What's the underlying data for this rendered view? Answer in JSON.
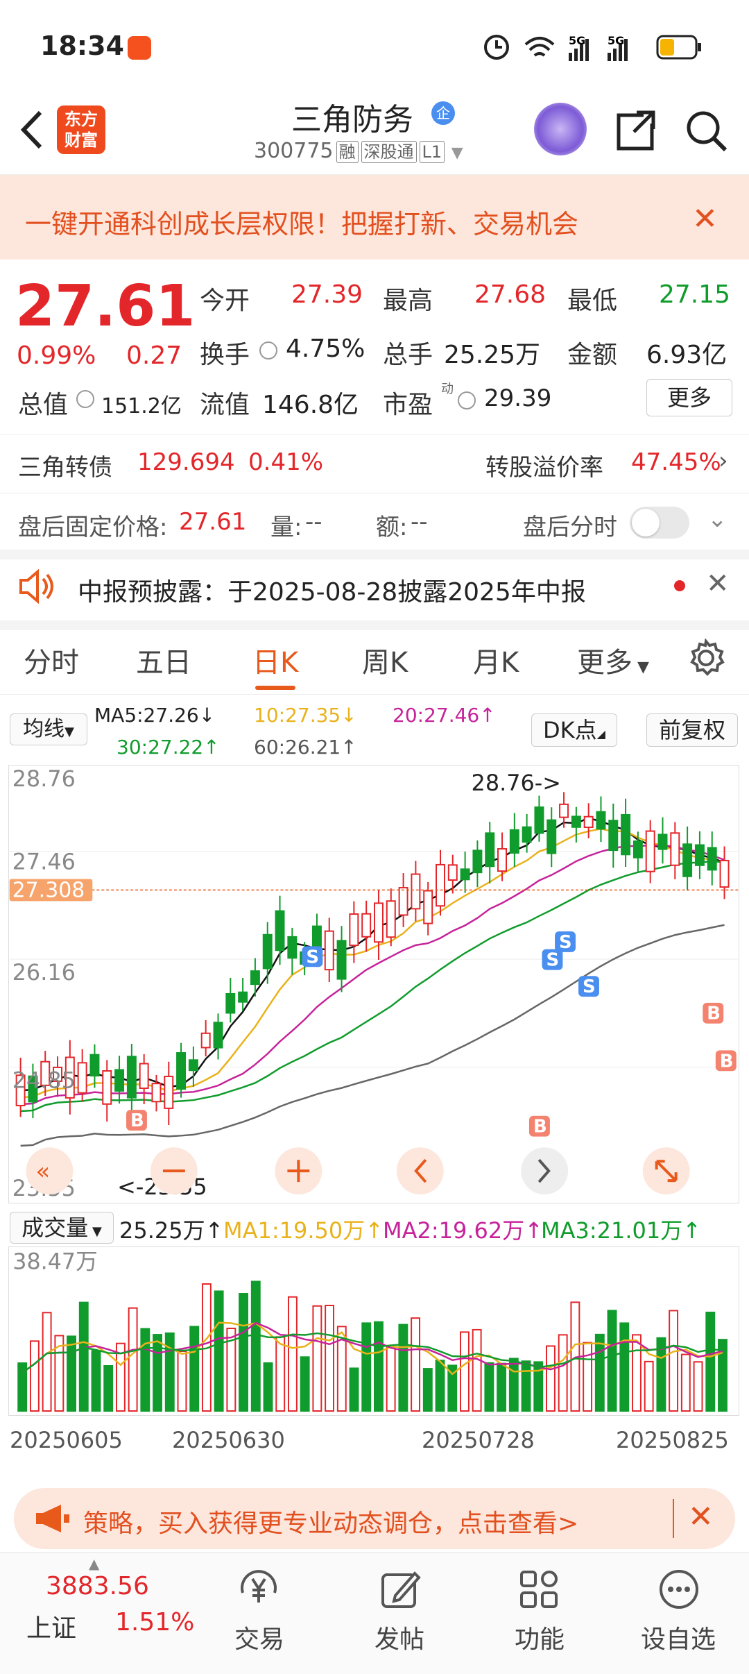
{
  "status": {
    "time": "18:34"
  },
  "header": {
    "logo_text": "东方财富",
    "title": "三角防务",
    "badge": "企",
    "code": "300775",
    "tags": [
      "融",
      "深股通",
      "L1"
    ]
  },
  "banner": {
    "text": "一键开通科创成长层权限！把握打新、交易机会"
  },
  "quote": {
    "price": "27.61",
    "pct": "0.99%",
    "change": "0.27",
    "open_label": "今开",
    "open": "27.39",
    "high_label": "最高",
    "high": "27.68",
    "low_label": "最低",
    "low": "27.15",
    "turnover_label": "换手",
    "turnover": "4.75%",
    "vol_label": "总手",
    "vol": "25.25万",
    "amount_label": "金额",
    "amount": "6.93亿",
    "mktcap_label": "总值",
    "mktcap": "151.2亿",
    "float_label": "流值",
    "float": "146.8亿",
    "pe_label": "市盈",
    "pe_sup": "动",
    "pe": "29.39",
    "more": "更多"
  },
  "bond": {
    "name": "三角转债",
    "price": "129.694",
    "pct": "0.41%",
    "premium_label": "转股溢价率",
    "premium": "47.45%"
  },
  "afterhours": {
    "label": "盘后固定价格:",
    "price": "27.61",
    "vol_label": "量:",
    "vol": "--",
    "amt_label": "额:",
    "amt": "--",
    "time_label": "盘后分时"
  },
  "notice": {
    "text": "中报预披露：于2025-08-28披露2025年中报"
  },
  "tabs": [
    "分时",
    "五日",
    "日K",
    "周K",
    "月K",
    "更多"
  ],
  "ma": {
    "selector": "均线",
    "ma5": "MA5:27.26↓",
    "ma10": "10:27.35↓",
    "ma20": "20:27.46↑",
    "ma30": "30:27.22↑",
    "ma60": "60:26.21↑",
    "dk": "DK点",
    "adjust": "前复权"
  },
  "kline": {
    "y_labels": [
      "28.76",
      "27.46",
      "26.16",
      "24.85",
      "23.55"
    ],
    "current_label": "27.308",
    "high_marker": "28.76->",
    "low_marker": "<-23.55",
    "buy": "B",
    "sell": "S"
  },
  "volume": {
    "selector": "成交量",
    "vol": "25.25万↑",
    "ma1": "MA1:19.50万↑",
    "ma2": "MA2:19.62万↑",
    "ma3": "MA3:21.01万↑",
    "max_label": "38.47万",
    "dates": [
      "20250605",
      "20250630",
      "20250728",
      "20250825"
    ]
  },
  "ad": {
    "text": "策略，买入获得更专业动态调仓，点击查看>"
  },
  "bottom": {
    "index_value": "3883.56",
    "index_name": "上证",
    "index_pct": "1.51%",
    "items": [
      "交易",
      "发帖",
      "功能",
      "设自选"
    ]
  },
  "colors": {
    "up": "#e3262a",
    "down": "#109c2c",
    "accent": "#e85a1c"
  }
}
